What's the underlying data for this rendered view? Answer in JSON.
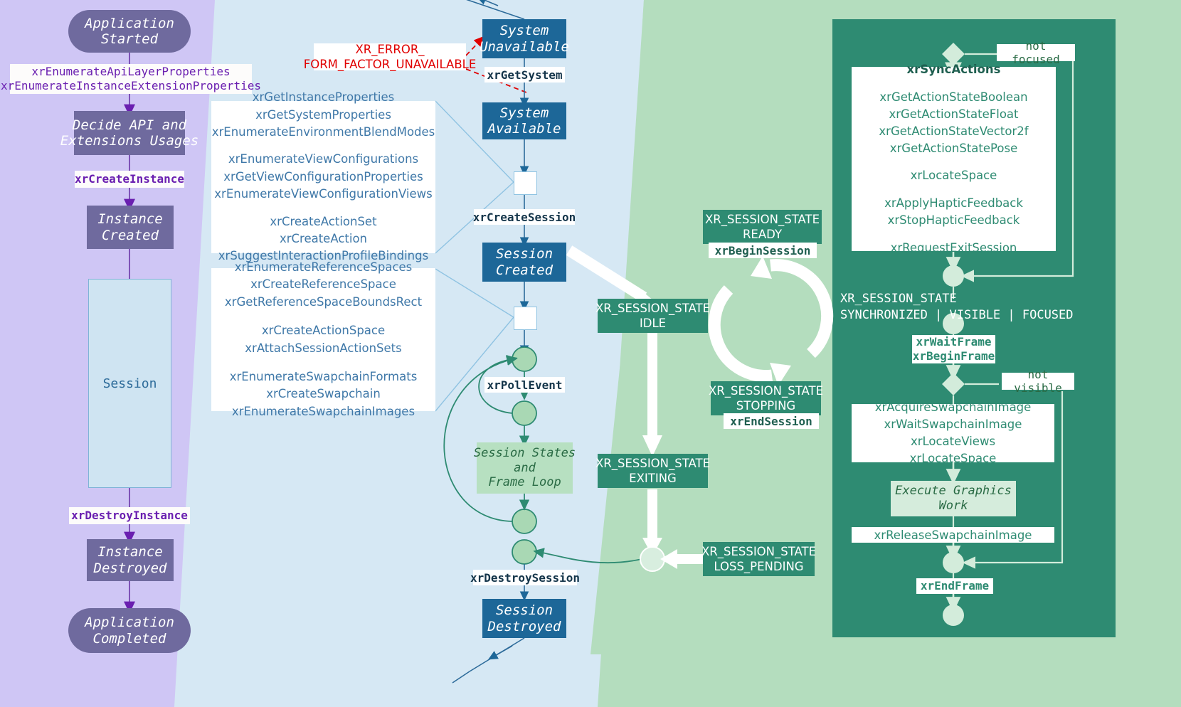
{
  "colors": {
    "bg_purple": "#cfc6f5",
    "bg_blue": "#d6e8f4",
    "bg_green": "#b4ddbe",
    "purple_node": "#6f6a9e",
    "purple_text": "#6a1fb0",
    "blue_node": "#1d6798",
    "blue_text": "#3f78a8",
    "green_node": "#2e8b72",
    "green_dark_panel": "#2e8b72",
    "error_red": "#e00000",
    "white": "#ffffff"
  },
  "instance_lane": {
    "start": "Application\nStarted",
    "enumerate_label": "xrEnumerateApiLayerProperties\nxrEnumerateInstanceExtensionProperties",
    "decide": "Decide API and\nExtensions Usages",
    "create_instance": "xrCreateInstance",
    "instance_created": "Instance\nCreated",
    "session_region": "Session",
    "destroy_instance": "xrDestroyInstance",
    "instance_destroyed": "Instance\nDestroyed",
    "completed": "Application\nCompleted"
  },
  "system_lane": {
    "error_label": "XR_ERROR_\nFORM_FACTOR_UNAVAILABLE",
    "system_unavailable": "System\nUnavailable",
    "get_system": "xrGetSystem",
    "system_available": "System\nAvailable",
    "create_session": "xrCreateSession",
    "session_created": "Session\nCreated",
    "poll_event": "xrPollEvent",
    "session_states_loop": "Session States\nand\nFrame Loop",
    "destroy_session": "xrDestroySession",
    "session_destroyed": "Session\nDestroyed"
  },
  "api_cards": [
    {
      "name": "instance-api-card",
      "groups": [
        [
          "xrGetInstanceProperties",
          "xrGetSystemProperties",
          "xrEnumerateEnvironmentBlendModes"
        ],
        [
          "xrEnumerateViewConfigurations",
          "xrGetViewConfigurationProperties",
          "xrEnumerateViewConfigurationViews"
        ],
        [
          "xrCreateActionSet",
          "xrCreateAction",
          "xrSuggestInteractionProfileBindings"
        ]
      ]
    },
    {
      "name": "session-api-card",
      "groups": [
        [
          "xrEnumerateReferenceSpaces",
          "xrCreateReferenceSpace",
          "xrGetReferenceSpaceBoundsRect"
        ],
        [
          "xrCreateActionSpace",
          "xrAttachSessionActionSets"
        ],
        [
          "xrEnumerateSwapchainFormats",
          "xrCreateSwapchain",
          "xrEnumerateSwapchainImages"
        ]
      ]
    }
  ],
  "session_states": {
    "idle": "XR_SESSION_STATE\nIDLE",
    "ready": "XR_SESSION_STATE\nREADY",
    "begin_session": "xrBeginSession",
    "stopping": "XR_SESSION_STATE\nSTOPPING",
    "end_session": "xrEndSession",
    "exiting": "XR_SESSION_STATE\nEXITING",
    "loss_pending": "XR_SESSION_STATE\nLOSS_PENDING"
  },
  "frame_loop": {
    "not_focused": "not focused",
    "sync_actions_title": "xrSyncActions",
    "sync_actions_groups": [
      [
        "xrGetActionStateBoolean",
        "xrGetActionStateFloat",
        "xrGetActionStateVector2f",
        "xrGetActionStatePose"
      ],
      [
        "xrLocateSpace"
      ],
      [
        "xrApplyHapticFeedback",
        "xrStopHapticFeedback"
      ],
      [
        "xrRequestExitSession"
      ]
    ],
    "state_line1": "XR_SESSION_STATE",
    "state_line2": "SYNCHRONIZED | VISIBLE | FOCUSED",
    "wait_begin_frame": "xrWaitFrame\nxrBeginFrame",
    "not_visible": "not visible",
    "swapchain_calls": [
      "xrAcquireSwapchainImage",
      "xrWaitSwapchainImage",
      "xrLocateViews",
      "xrLocateSpace"
    ],
    "execute_graphics": "Execute Graphics\nWork",
    "release_swapchain": "xrReleaseSwapchainImage",
    "end_frame": "xrEndFrame"
  }
}
